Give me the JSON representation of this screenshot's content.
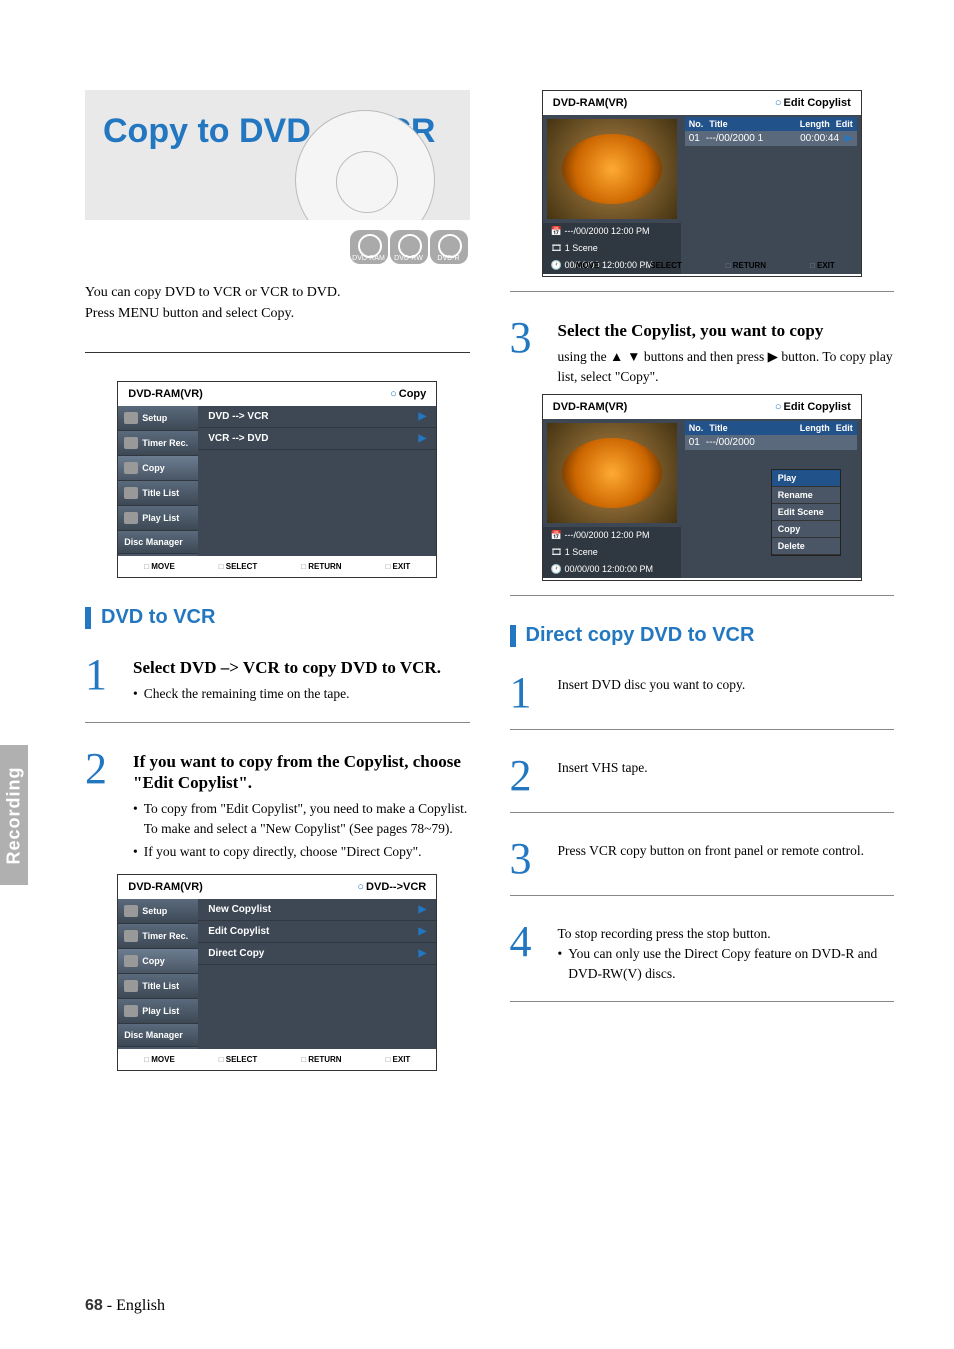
{
  "side_tab": "Recording",
  "banner": {
    "title": "Copy to DVD or VCR",
    "discs": [
      "DVD-RAM",
      "DVD-RW",
      "DVD-R"
    ]
  },
  "intro": {
    "line1": "You can copy DVD to VCR or VCR to DVD.",
    "line2": "Press MENU button and select Copy."
  },
  "osd1": {
    "device": "DVD-RAM(VR)",
    "mode": "Copy",
    "side": {
      "setup": "Setup",
      "timer": "Timer Rec.",
      "copy": "Copy",
      "title": "Title List",
      "play": "Play List",
      "disc": "Disc Manager"
    },
    "main": {
      "a": "DVD --> VCR",
      "b": "VCR --> DVD"
    },
    "footer": {
      "move": "MOVE",
      "select": "SELECT",
      "return": "RETURN",
      "exit": "EXIT"
    }
  },
  "section_dvd_vcr": "DVD to VCR",
  "step1": {
    "title": "Select DVD –> VCR to copy DVD to VCR.",
    "bullet1": "Check the remaining time on the tape."
  },
  "step2": {
    "title": "If you want to copy from the Copylist, choose \"Edit Copylist\".",
    "bullet1": "To copy from \"Edit Copylist\", you need to make a Copylist. To make and select a \"New Copylist\" (See pages 78~79).",
    "bullet2": "If you want to copy directly, choose \"Direct Copy\"."
  },
  "osd2": {
    "device": "DVD-RAM(VR)",
    "mode": "DVD-->VCR",
    "main": {
      "a": "New Copylist",
      "b": "Edit Copylist",
      "c": "Direct Copy"
    }
  },
  "osd3": {
    "device": "DVD-RAM(VR)",
    "mode": "Edit Copylist",
    "cols": {
      "no": "No.",
      "title": "Title",
      "length": "Length",
      "edit": "Edit"
    },
    "row": {
      "no": "01",
      "title": "---/00/2000 1",
      "length": "00:00:44"
    },
    "meta": {
      "date": "---/00/2000 12:00 PM",
      "scene": "1 Scene",
      "clock": "00/00/00 12:00:00 PM"
    }
  },
  "step3": {
    "title": "Select the Copylist, you want to copy",
    "body_a": "using the ",
    "body_b": " buttons and then press ",
    "body_c": " button. To copy play list, select \"Copy\"."
  },
  "osd4": {
    "device": "DVD-RAM(VR)",
    "mode": "Edit Copylist",
    "row": {
      "no": "01",
      "title": "---/00/2000"
    },
    "context": {
      "play": "Play",
      "rename": "Rename",
      "editscene": "Edit Scene",
      "copy": "Copy",
      "delete": "Delete"
    },
    "meta": {
      "date": "---/00/2000 12:00 PM",
      "scene": "1 Scene",
      "clock": "00/00/00 12:00:00 PM"
    }
  },
  "section_direct": "Direct copy DVD to VCR",
  "dstep1": "Insert DVD disc you want to copy.",
  "dstep2": "Insert VHS tape.",
  "dstep3": "Press VCR copy button on front panel or remote control.",
  "dstep4": {
    "a": "To stop recording press the stop button.",
    "b": "You can only use the Direct Copy feature on DVD-R and DVD-RW(V) discs."
  },
  "footer": {
    "page": "68",
    "dash": " - ",
    "lang": "English"
  }
}
